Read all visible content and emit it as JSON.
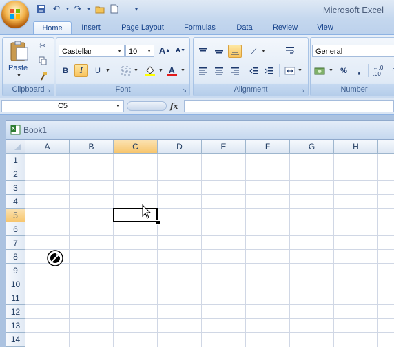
{
  "app": {
    "title": "Microsoft Excel"
  },
  "tabs": [
    {
      "label": "Home",
      "active": true
    },
    {
      "label": "Insert"
    },
    {
      "label": "Page Layout"
    },
    {
      "label": "Formulas"
    },
    {
      "label": "Data"
    },
    {
      "label": "Review"
    },
    {
      "label": "View"
    }
  ],
  "clipboard": {
    "group_label": "Clipboard",
    "paste_label": "Paste"
  },
  "font": {
    "group_label": "Font",
    "font_name": "Castellar",
    "font_size": "10",
    "bold": "B",
    "italic": "I",
    "underline": "U",
    "grow": "A",
    "shrink": "A"
  },
  "alignment": {
    "group_label": "Alignment"
  },
  "number": {
    "group_label": "Number",
    "format": "General",
    "percent": "%",
    "comma": ","
  },
  "formula_bar": {
    "name_box": "C5",
    "fx": "fx",
    "value": ""
  },
  "workbook": {
    "name": "Book1"
  },
  "grid": {
    "columns": [
      "A",
      "B",
      "C",
      "D",
      "E",
      "F",
      "G",
      "H"
    ],
    "rows": [
      "1",
      "2",
      "3",
      "4",
      "5",
      "6",
      "7",
      "8",
      "9",
      "10",
      "11",
      "12",
      "13",
      "14"
    ],
    "selected_cell": "C5",
    "selected_column": "C",
    "selected_row": "5"
  },
  "colors": {
    "accent": "#f7c66e",
    "ribbon": "#dbe7f5",
    "tab_text": "#15428b"
  }
}
